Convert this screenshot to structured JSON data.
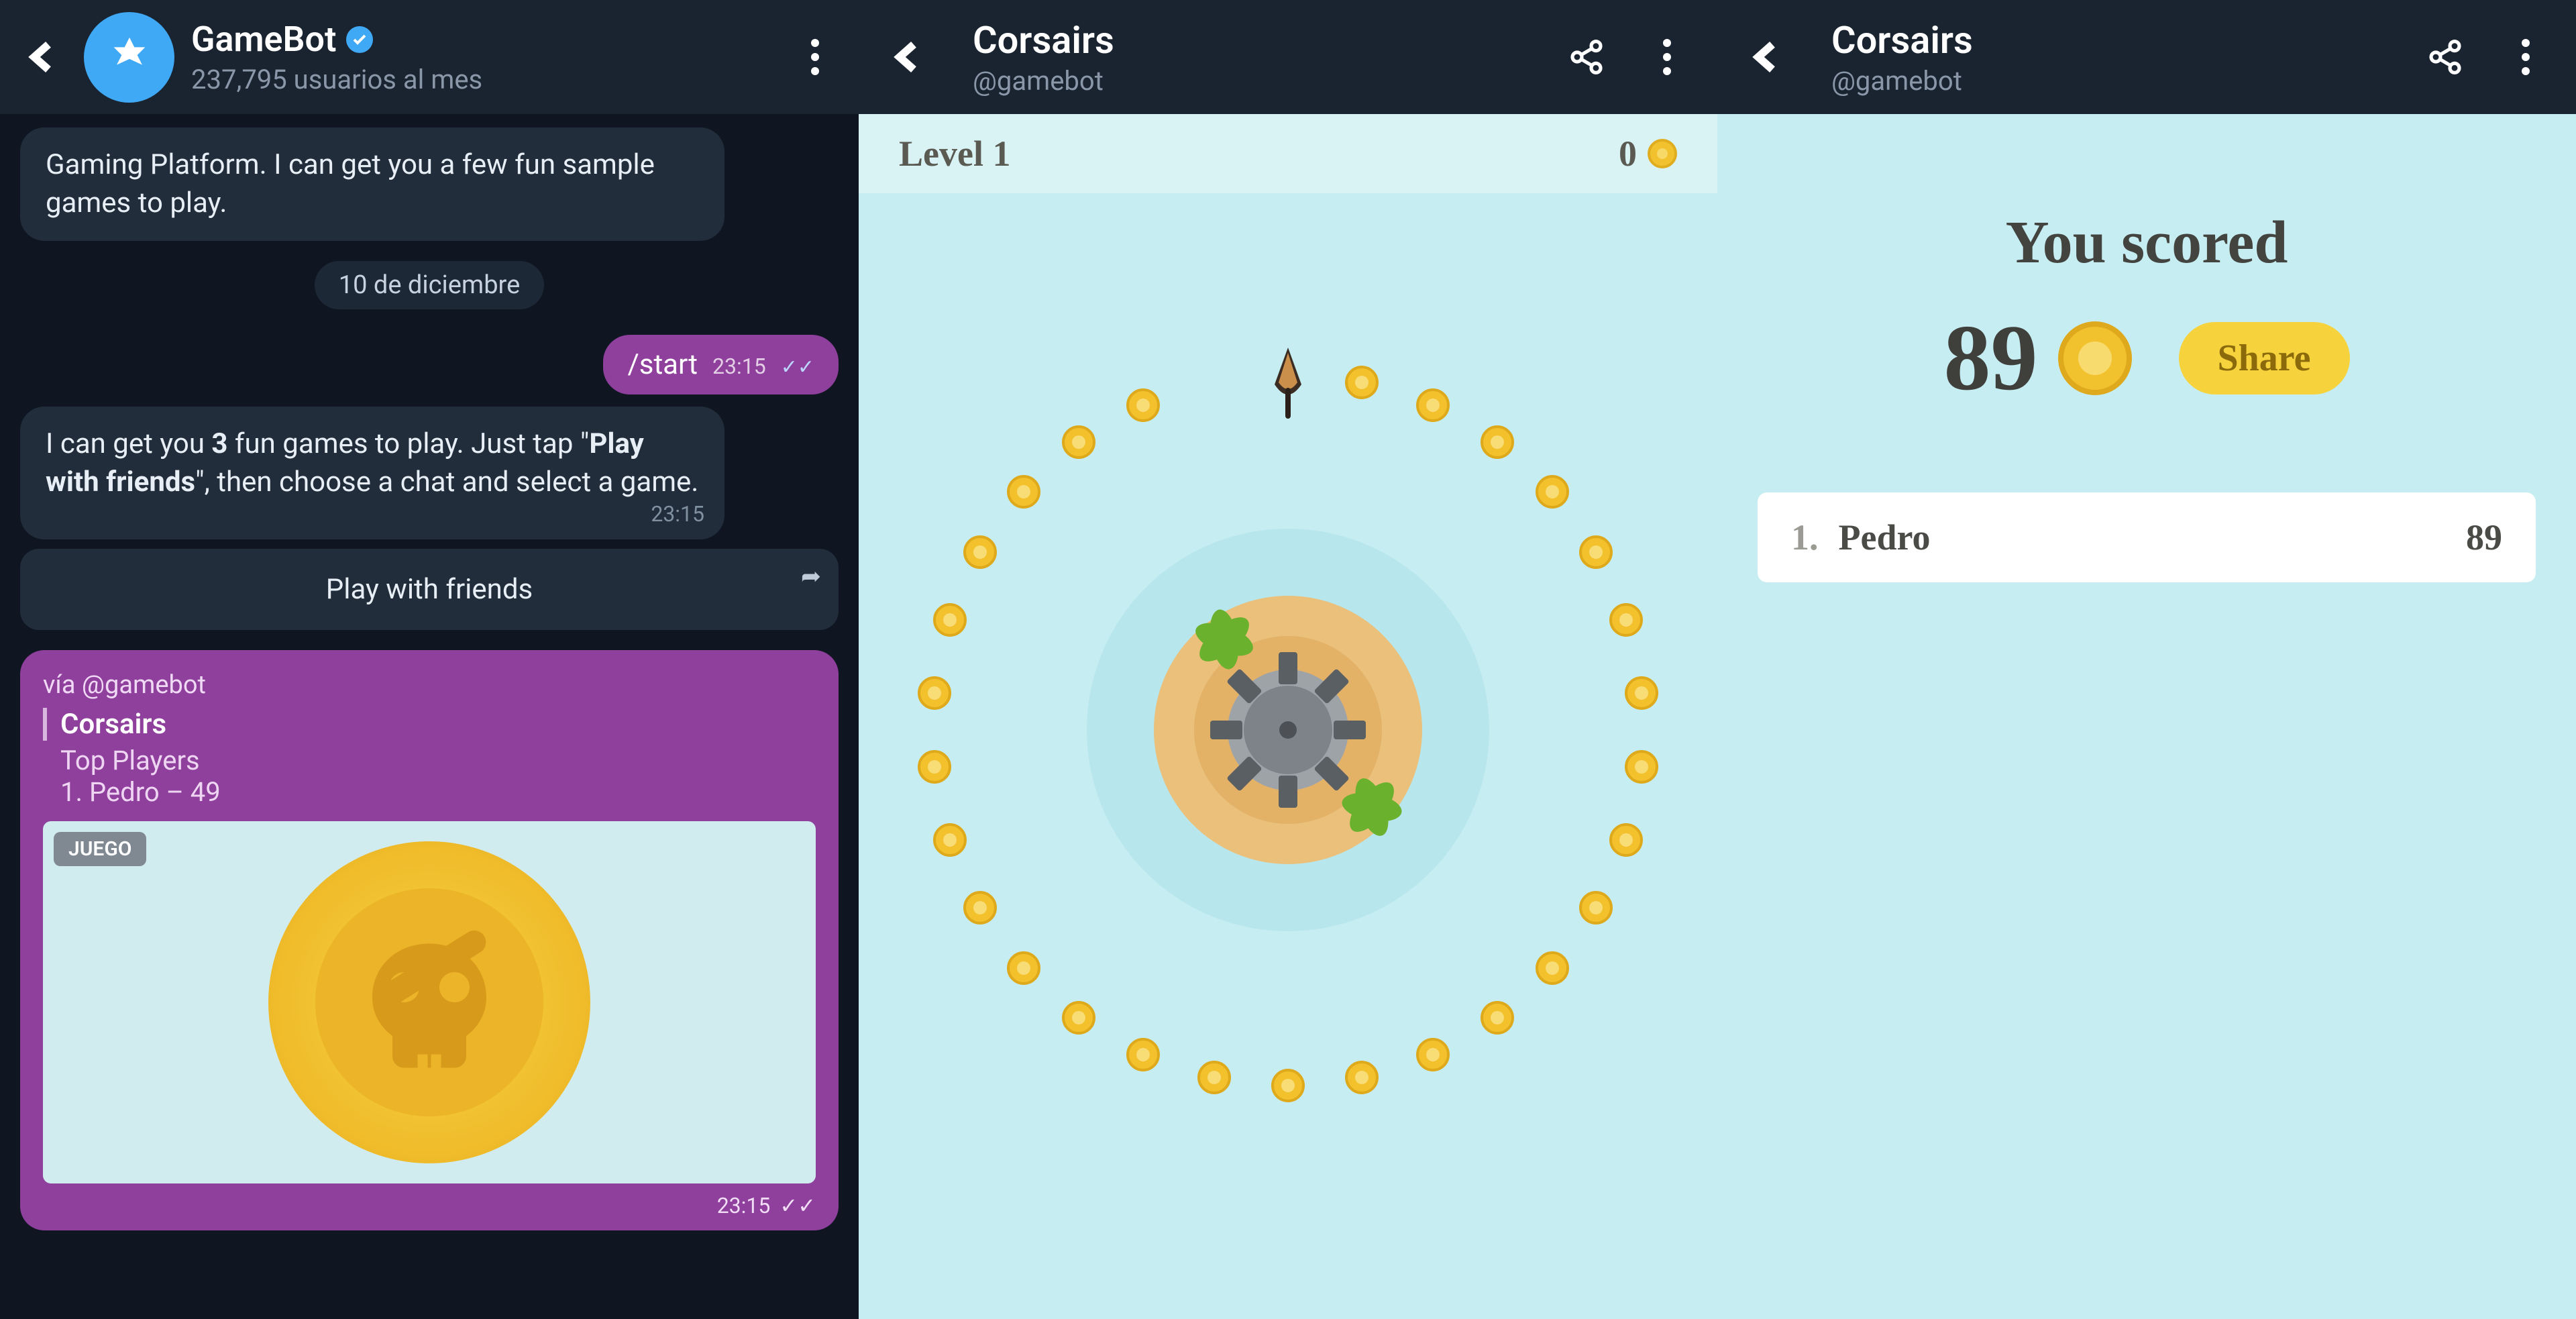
{
  "panel1": {
    "bot_name": "GameBot",
    "subtitle": "237,795 usuarios al mes",
    "intro_msg": "Gaming Platform. I can get you a few fun sample games to play.",
    "date": "10 de diciembre",
    "start_cmd": "/start",
    "start_time": "23:15",
    "instruction_pre": "I can get you ",
    "instruction_bold1": "3",
    "instruction_mid": " fun games to play. Just tap \"",
    "instruction_bold2": "Play with friends",
    "instruction_post": "\", then choose a chat and select a game.",
    "instruction_time": "23:15",
    "play_button": "Play with friends",
    "via": "vía @gamebot",
    "game_name": "Corsairs",
    "top_players": "Top Players",
    "score_line": "1. Pedro – 49",
    "badge": "JUEGO",
    "card_time": "23:15"
  },
  "panel2": {
    "title": "Corsairs",
    "subtitle": "@gamebot",
    "level": "Level 1",
    "score": "0"
  },
  "panel3": {
    "title": "Corsairs",
    "subtitle": "@gamebot",
    "you_scored": "You scored",
    "score": "89",
    "share": "Share",
    "lb_rank": "1.",
    "lb_name": "Pedro",
    "lb_score": "89"
  }
}
